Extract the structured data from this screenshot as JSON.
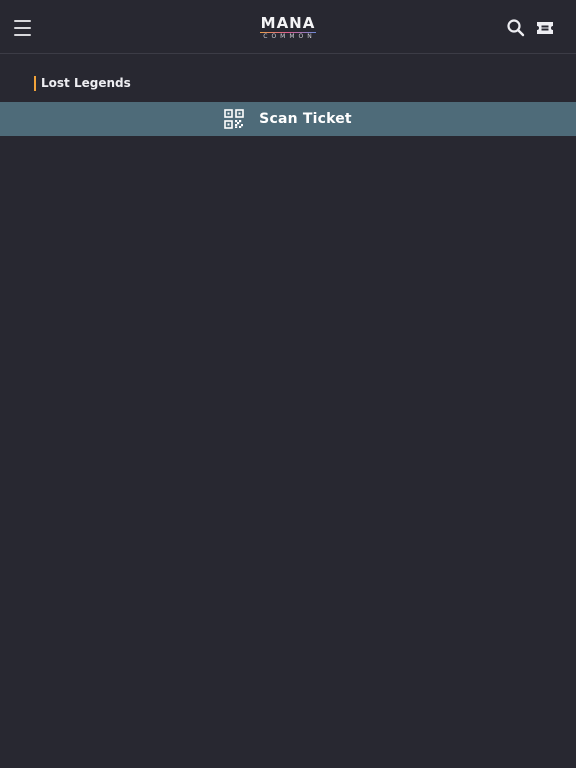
{
  "header": {
    "logo_main": "MANA",
    "logo_sub": "COMMON",
    "menu_icon": "hamburger-menu-icon",
    "search_icon": "search-icon",
    "ticket_icon": "ticket-icon"
  },
  "breadcrumb": {
    "label": "Lost Legends",
    "accent_color": "#f2a33a"
  },
  "scan_bar": {
    "label": "Scan Ticket",
    "icon": "qr-code-icon",
    "background_color": "#4e6b79"
  },
  "colors": {
    "background": "#282831",
    "text": "#eeeef2"
  }
}
